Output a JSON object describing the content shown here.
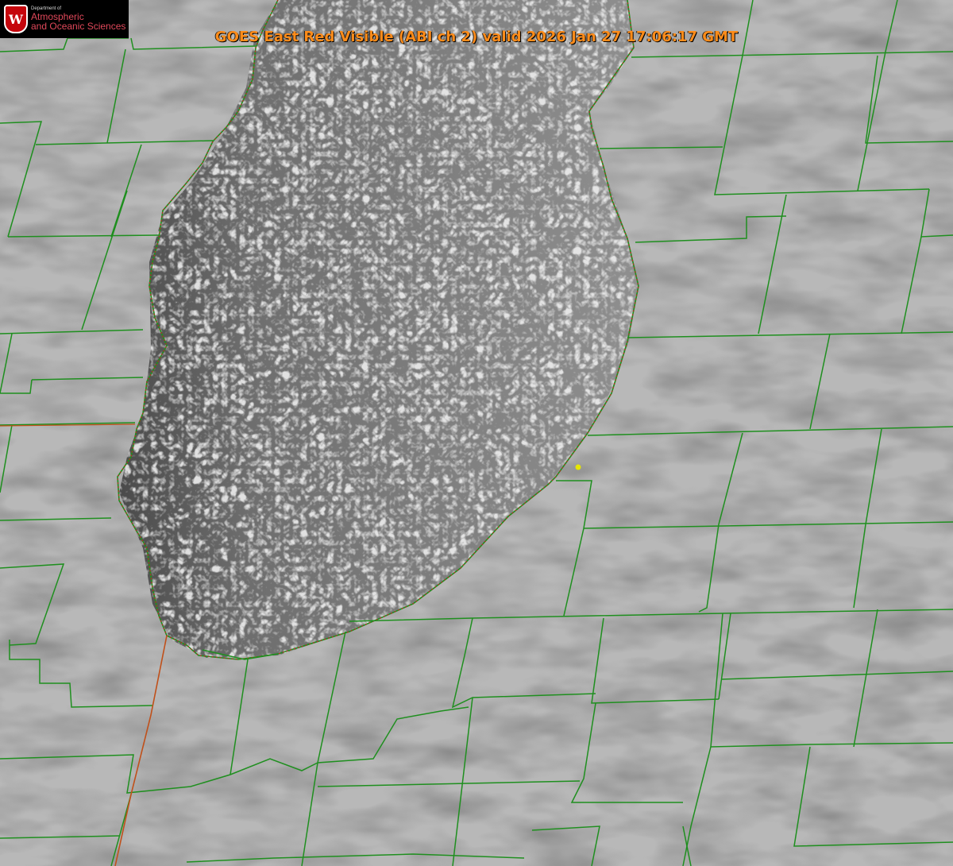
{
  "title": "GOES East Red Visible (ABI ch 2) valid 2026 Jan 27 17:06:17 GMT",
  "logo": {
    "department": "Department of",
    "line1": "Atmospheric",
    "line2": "and Oceanic Sciences",
    "crest_letter": "W"
  },
  "colors": {
    "county_lines": "#1f8f1f",
    "state_line": "#d04020",
    "lake_outline_dotted": "#d02020",
    "title_text": "#ff8c1a",
    "marker": "#e6e600"
  },
  "icons": [
    "uw-crest-icon",
    "location-marker-icon"
  ]
}
